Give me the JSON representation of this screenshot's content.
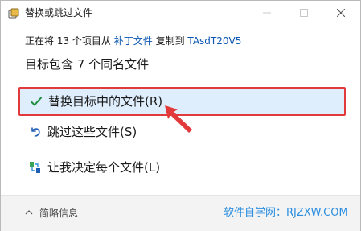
{
  "window": {
    "title": "替换或跳过文件",
    "icon": "folder-copy-icon",
    "controls": [
      "minimize",
      "maximize",
      "close"
    ]
  },
  "status": {
    "prefix": "正在将 13 个项目从",
    "source": "补丁文件",
    "middle": "复制到",
    "destination": "TAsdT20V5"
  },
  "heading": "目标包含 7 个同名文件",
  "options": [
    {
      "label": "替换目标中的文件(R)",
      "icon": "checkmark-icon",
      "selected": true
    },
    {
      "label": "跳过这些文件(S)",
      "icon": "skip-arrow-icon",
      "selected": false
    },
    {
      "label": "让我决定每个文件(L)",
      "icon": "decide-files-icon",
      "selected": false
    }
  ],
  "footer": {
    "details_label": "简略信息",
    "watermark": "软件自学网：RJZXW.COM"
  },
  "colors": {
    "accent": "#0b57b3",
    "highlight_bg": "#dfeefc",
    "annotation_red": "#e23a3a",
    "watermark_blue": "#2a8ee0"
  }
}
